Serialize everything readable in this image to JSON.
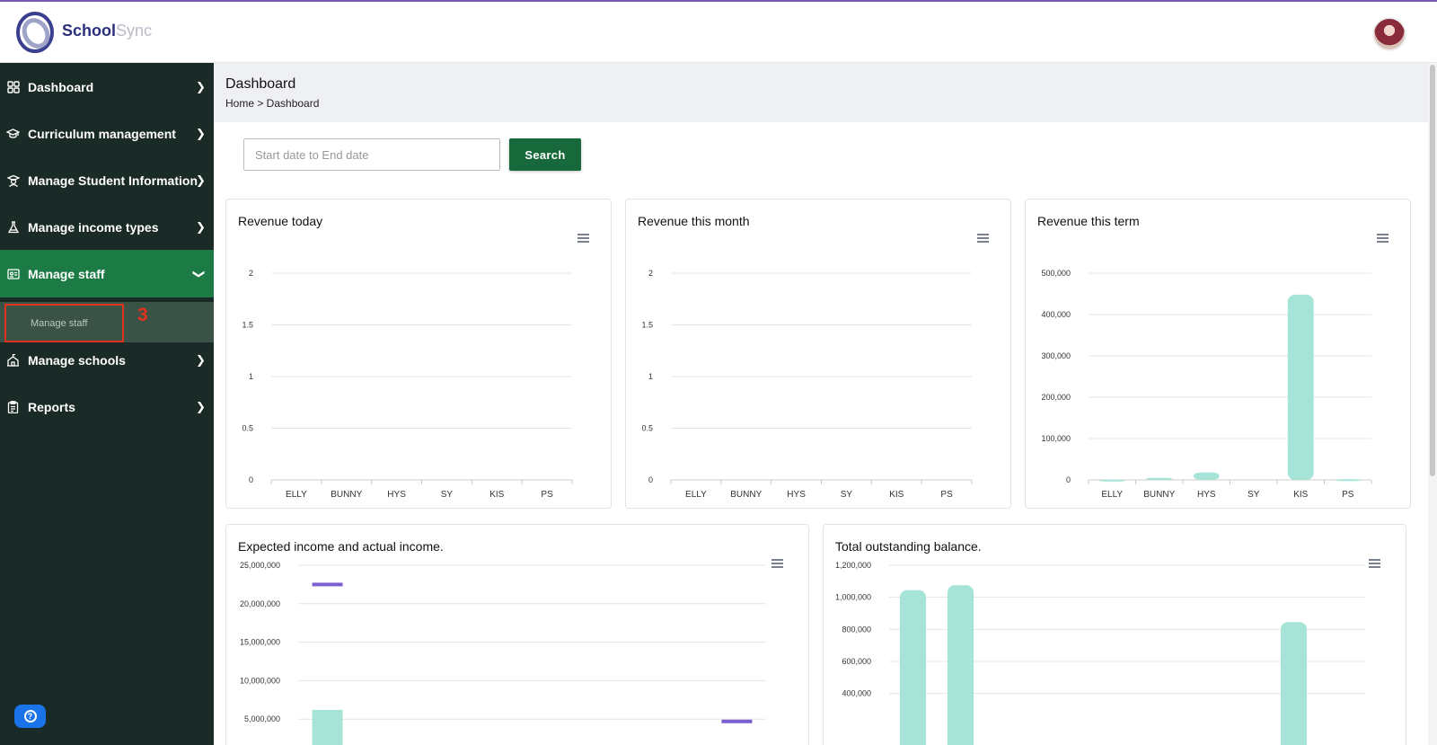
{
  "header": {
    "brand_part1": "School",
    "brand_part2": "Sync"
  },
  "sidebar": {
    "items": [
      {
        "label": "Dashboard",
        "icon": "grid-icon"
      },
      {
        "label": "Curriculum management",
        "icon": "graduation-cap-icon"
      },
      {
        "label": "Manage Student Information",
        "icon": "student-icon"
      },
      {
        "label": "Manage income types",
        "icon": "flask-icon"
      },
      {
        "label": "Manage staff",
        "icon": "id-card-icon",
        "expanded": true
      },
      {
        "label": "Manage schools",
        "icon": "school-icon"
      },
      {
        "label": "Reports",
        "icon": "clipboard-icon"
      }
    ],
    "sub_item": "Manage staff",
    "annotation": "3"
  },
  "page": {
    "title": "Dashboard",
    "breadcrumb": "Home > Dashboard",
    "date_placeholder": "Start date to End date",
    "search_label": "Search"
  },
  "colors": {
    "sidebar_bg": "#1a2b27",
    "active_green": "#1c7a44",
    "bar_color": "#a5e4d6",
    "marker_color": "#7b5fd1",
    "annotation_red": "#e0321c"
  },
  "chart_data": [
    {
      "type": "bar",
      "title": "Revenue today",
      "categories": [
        "ELLY",
        "BUNNY",
        "HYS",
        "SY",
        "KIS",
        "PS"
      ],
      "values": [
        0,
        0,
        0,
        0,
        0,
        0
      ],
      "ylim": [
        0,
        2
      ],
      "yticks": [
        "0",
        "0.5",
        "1",
        "1.5",
        "2"
      ],
      "grid": true
    },
    {
      "type": "bar",
      "title": "Revenue this month",
      "categories": [
        "ELLY",
        "BUNNY",
        "HYS",
        "SY",
        "KIS",
        "PS"
      ],
      "values": [
        0,
        0,
        0,
        0,
        0,
        0
      ],
      "ylim": [
        0,
        2
      ],
      "yticks": [
        "0",
        "0.5",
        "1",
        "1.5",
        "2"
      ],
      "grid": true
    },
    {
      "type": "bar",
      "title": "Revenue this term",
      "categories": [
        "ELLY",
        "BUNNY",
        "HYS",
        "SY",
        "KIS",
        "PS"
      ],
      "values": [
        500,
        5000,
        18000,
        0,
        448000,
        1500
      ],
      "ylim": [
        0,
        500000
      ],
      "yticks": [
        "0",
        "100,000",
        "200,000",
        "300,000",
        "400,000",
        "500,000"
      ],
      "grid": true
    },
    {
      "type": "bar",
      "title": "Expected income and actual income.",
      "categories": [
        "",
        "",
        "",
        "",
        "",
        "",
        "",
        ""
      ],
      "series": [
        {
          "values": [
            6200000,
            0,
            0,
            0,
            0,
            0,
            0,
            0
          ]
        },
        {
          "values": [
            22500000,
            null,
            null,
            null,
            null,
            null,
            null,
            4700000
          ]
        }
      ],
      "ylim": [
        0,
        25000000
      ],
      "yticks": [
        "5,000,000",
        "10,000,000",
        "15,000,000",
        "20,000,000",
        "25,000,000"
      ],
      "grid": true
    },
    {
      "type": "bar",
      "title": "Total outstanding balance.",
      "categories": [
        "",
        "",
        "",
        "",
        "",
        "",
        "",
        "",
        "",
        ""
      ],
      "values": [
        1045000,
        1075000,
        0,
        0,
        0,
        0,
        0,
        0,
        845000,
        0
      ],
      "ylim": [
        0,
        1200000
      ],
      "yticks": [
        "400,000",
        "600,000",
        "800,000",
        "1,000,000",
        "1,200,000"
      ],
      "grid": true
    }
  ]
}
